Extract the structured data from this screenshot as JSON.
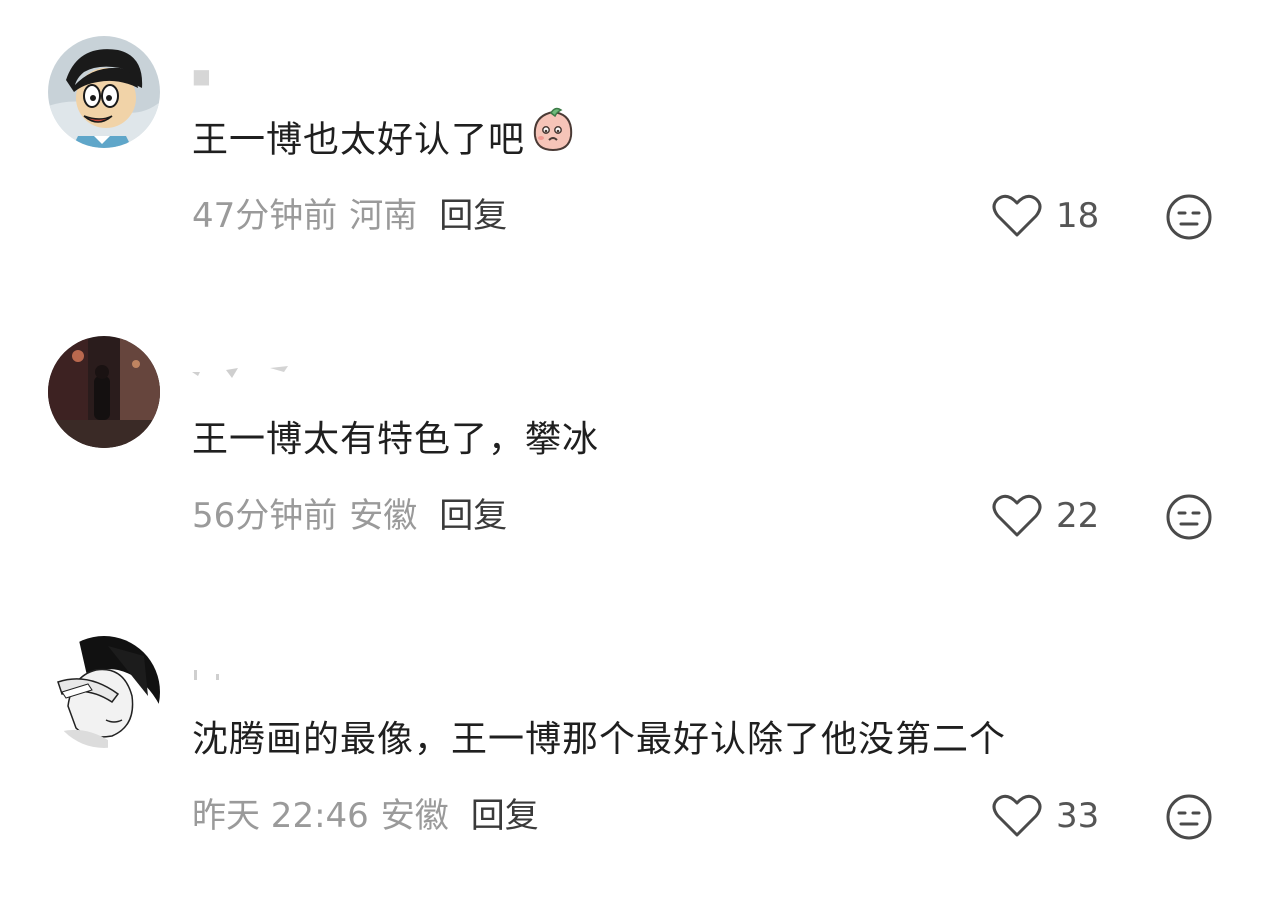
{
  "comments": [
    {
      "username": "■",
      "text": "王一博也太好认了吧",
      "emoji": "peach-face-emoji",
      "time": "47分钟前",
      "location": "河南",
      "reply_label": "回复",
      "likes": "18",
      "avatar": "cartoon-boy-avatar"
    },
    {
      "username": "",
      "text": "王一博太有特色了，攀冰",
      "time": "56分钟前",
      "location": "安徽",
      "reply_label": "回复",
      "likes": "22",
      "avatar": "night-street-photo-avatar"
    },
    {
      "username": "",
      "text": "沈腾画的最像，王一博那个最好认除了他没第二个",
      "time": "昨天 22:46",
      "location": "安徽",
      "reply_label": "回复",
      "likes": "33",
      "avatar": "anime-sketch-avatar"
    }
  ],
  "colors": {
    "text": "#1f1f1f",
    "meta": "#9a9a9a",
    "reply": "#3a3a3a",
    "icon": "#4a4a4a"
  }
}
